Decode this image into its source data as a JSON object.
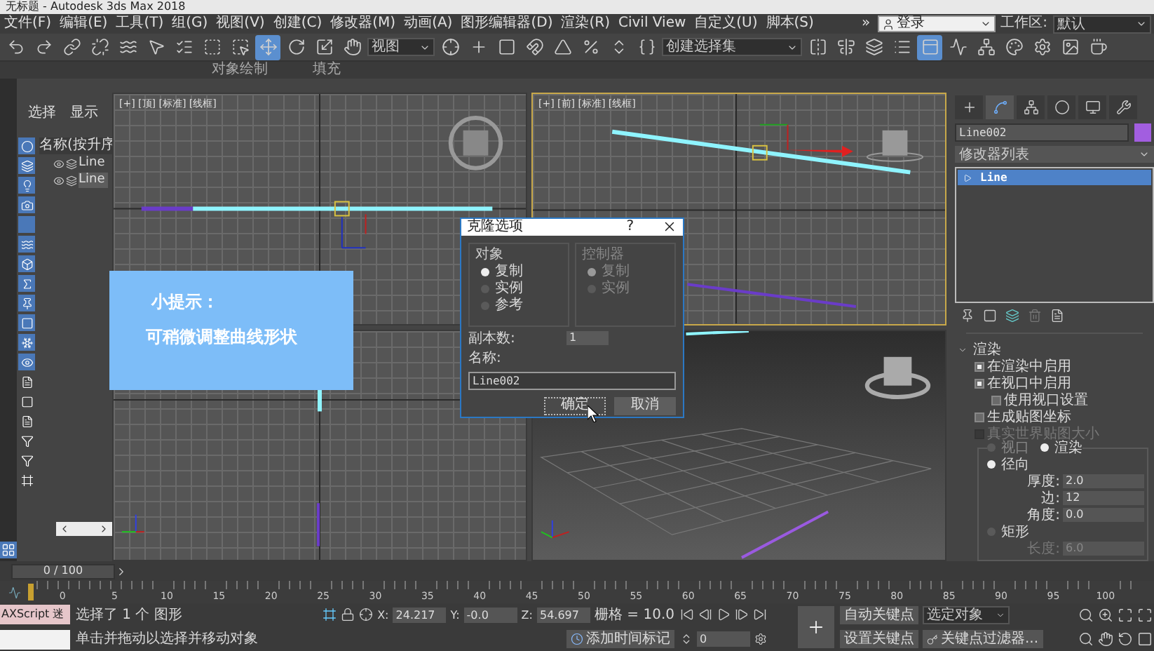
{
  "title": "无标题 - Autodesk 3ds Max 2018",
  "menu": [
    "文件(F)",
    "编辑(E)",
    "工具(T)",
    "组(G)",
    "视图(V)",
    "创建(C)",
    "修改器(M)",
    "动画(A)",
    "图形编辑器(D)",
    "渲染(R)",
    "Civil View",
    "自定义(U)",
    "脚本(S)"
  ],
  "menu_more": "»",
  "login": "登录",
  "workspace_label": "工作区:",
  "workspace": "默认",
  "toolbar": [
    {
      "kind": "undo",
      "selected": false
    },
    {
      "kind": "redo",
      "selected": false
    },
    {
      "kind": "link",
      "selected": false
    },
    {
      "kind": "unlink",
      "selected": false
    },
    {
      "kind": "bind",
      "selected": false
    },
    {
      "kind": "select",
      "selected": false
    },
    {
      "kind": "select-by-name",
      "selected": false
    },
    {
      "kind": "rect-region",
      "selected": false
    },
    {
      "kind": "window-crossing",
      "selected": false
    },
    {
      "kind": "move",
      "selected": true
    },
    {
      "kind": "rotate",
      "selected": false
    },
    {
      "kind": "scale",
      "selected": false
    },
    {
      "kind": "placement",
      "selected": false
    },
    {
      "kind": "dropdown",
      "label": "视图",
      "selected": false
    },
    {
      "kind": "pivot",
      "selected": false
    },
    {
      "kind": "manipulate",
      "selected": false
    },
    {
      "kind": "shortcut",
      "selected": false
    },
    {
      "kind": "snap",
      "selected": false
    },
    {
      "kind": "angle-snap",
      "selected": false
    },
    {
      "kind": "percent-snap",
      "selected": false
    },
    {
      "kind": "spinner-snap",
      "selected": false
    },
    {
      "kind": "named-sel",
      "selected": false
    },
    {
      "kind": "dropdown",
      "label": "创建选择集",
      "selected": false
    },
    {
      "kind": "mirror",
      "selected": false
    },
    {
      "kind": "align",
      "selected": false
    },
    {
      "kind": "layers",
      "selected": false
    },
    {
      "kind": "scene-list",
      "selected": false
    },
    {
      "kind": "ribbon",
      "selected": true
    },
    {
      "kind": "curve-editor",
      "selected": false
    },
    {
      "kind": "schematic",
      "selected": false
    },
    {
      "kind": "material",
      "selected": false
    },
    {
      "kind": "render-setup",
      "selected": false
    },
    {
      "kind": "render-frame",
      "selected": false
    },
    {
      "kind": "render",
      "selected": false
    }
  ],
  "ribbon_tabs": [
    "对象绘制",
    "填充"
  ],
  "scene_explorer": {
    "tabs": [
      "选择",
      "显示"
    ],
    "header": "名称(按升序",
    "items": [
      {
        "label": "Line",
        "selected": false
      },
      {
        "label": "Line",
        "selected": true
      }
    ]
  },
  "viewports": [
    {
      "kind": "top",
      "label": "[+] [顶] [标准] [线框]",
      "active": false
    },
    {
      "kind": "front",
      "label": "[+] [前] [标准] [线框]",
      "active": true
    },
    {
      "kind": "left",
      "active": false
    },
    {
      "kind": "perspective",
      "active": false
    }
  ],
  "tip": {
    "title": "小提示：",
    "text": "可稍微调整曲线形状"
  },
  "dialog": {
    "title": "克隆选项",
    "help": "?",
    "object_group": {
      "label": "对象",
      "disabled": false,
      "options": [
        {
          "label": "复制",
          "selected": true
        },
        {
          "label": "实例",
          "selected": false
        },
        {
          "label": "参考",
          "selected": false
        }
      ]
    },
    "controller_group": {
      "label": "控制器",
      "disabled": true,
      "options": [
        {
          "label": "复制",
          "selected": true
        },
        {
          "label": "实例",
          "selected": false
        }
      ]
    },
    "copies_label": "副本数:",
    "copies": "1",
    "name_label": "名称:",
    "name": "Line002",
    "buttons": [
      "确定",
      "取消"
    ]
  },
  "command_panel": {
    "tabs": [
      {
        "kind": "create",
        "selected": false
      },
      {
        "kind": "modify",
        "selected": true
      },
      {
        "kind": "hierarchy",
        "selected": false
      },
      {
        "kind": "motion",
        "selected": false
      },
      {
        "kind": "display",
        "selected": false
      },
      {
        "kind": "utilities",
        "selected": false
      }
    ],
    "object_name": "Line002",
    "modifier_list": "修改器列表",
    "stack": [
      {
        "label": "Line",
        "selected": true
      }
    ],
    "rollout": {
      "title": "渲染",
      "expanded": true,
      "options": [
        {
          "label": "在渲染中启用",
          "checked": true,
          "disabled": false
        },
        {
          "label": "在视口中启用",
          "checked": true,
          "disabled": false,
          "children": [
            {
              "label": "使用视口设置",
              "checked": false,
              "disabled": false
            }
          ]
        },
        {
          "label": "生成贴图坐标",
          "checked": false,
          "disabled": false
        },
        {
          "label": "真实世界贴图大小",
          "checked": false,
          "disabled": true
        }
      ],
      "modes": [
        {
          "label": "视口",
          "selected": false
        },
        {
          "label": "渲染",
          "selected": true
        }
      ],
      "shapes": [
        {
          "label": "径向",
          "selected": true,
          "params": [
            {
              "label": "厚度:",
              "value": "2.0",
              "disabled": false
            },
            {
              "label": "边:",
              "value": "12",
              "disabled": false
            },
            {
              "label": "角度:",
              "value": "0.0",
              "disabled": false
            }
          ]
        },
        {
          "label": "矩形",
          "selected": false,
          "params": [
            {
              "label": "长度:",
              "value": "6.0",
              "disabled": true
            }
          ]
        }
      ]
    }
  },
  "timeline": {
    "frame": "0 / 100",
    "level": 0,
    "ticks": [
      "0",
      "5",
      "10",
      "15",
      "20",
      "25",
      "30",
      "35",
      "40",
      "45",
      "50",
      "55",
      "60",
      "65",
      "70",
      "75",
      "80",
      "85",
      "90",
      "95",
      "100"
    ]
  },
  "status": {
    "maxscript": "AXScript 迷",
    "selected_text": "选择了 1 个 图形",
    "prompt": "单击并拖动以选择并移动对象",
    "coords": [
      {
        "axis": "X:",
        "value": "24.217"
      },
      {
        "axis": "Y:",
        "value": "-0.0"
      },
      {
        "axis": "Z:",
        "value": "54.697"
      }
    ],
    "grid": "栅格 = 10.0",
    "time_tag": "添加时间标记",
    "frame": "0",
    "auto_key": "自动关键点",
    "set_key": "设置关键点",
    "key_mode": "选定对象",
    "key_filters": "关键点过滤器..."
  }
}
